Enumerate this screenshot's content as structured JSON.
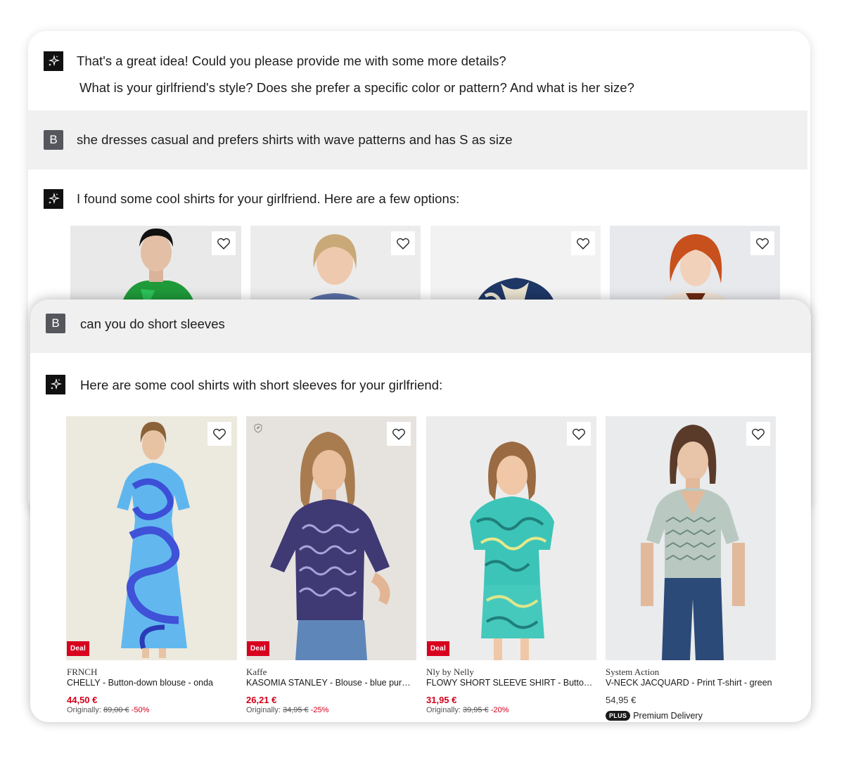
{
  "colors": {
    "accent_red": "#d3001a",
    "band_gray": "#f0f0f0",
    "bot_avatar": "#111111",
    "user_avatar": "#55575d"
  },
  "back_chat": {
    "bot_message_1_line1": "That's a great idea! Could you please provide me with some more details?",
    "bot_message_1_line2": "What is your girlfriend's style? Does she prefer a specific color or pattern? And what is her size?",
    "user_initial": "B",
    "user_message_1": "she dresses casual and prefers shirts with wave patterns and has S as size",
    "bot_message_2": "I found some cool shirts for your girlfriend. Here are a few options:"
  },
  "front_chat": {
    "user_initial": "B",
    "user_message": "can you do short sleeves",
    "bot_message": "Here are some cool shirts with short sleeves for your girlfriend:"
  },
  "products": [
    {
      "brand": "FRNCH",
      "name": "CHELLY - Button-down blouse - onda",
      "price": "44,50 €",
      "orig_label": "Originally:",
      "orig_price": "89,00 €",
      "discount": "-50%",
      "badge": "Deal"
    },
    {
      "brand": "Kaffe",
      "name": "KASOMIA STANLEY - Blouse - blue purpl...",
      "price": "26,21 €",
      "orig_label": "Originally:",
      "orig_price": "34,95 €",
      "discount": "-25%",
      "badge": "Deal"
    },
    {
      "brand": "Nly by Nelly",
      "name": "FLOWY SHORT SLEEVE SHIRT - Button-...",
      "price": "31,95 €",
      "orig_label": "Originally:",
      "orig_price": "39,95 €",
      "discount": "-20%",
      "badge": "Deal"
    },
    {
      "brand": "System Action",
      "name": "V-NECK JACQUARD - Print T-shirt - green",
      "price": "54,95 €",
      "plus_badge": "PLUS",
      "delivery": "Premium Delivery"
    }
  ],
  "icons": {
    "bot": "sparkle-icon",
    "favorite": "heart-icon",
    "sustainability": "leaf-badge-icon"
  }
}
